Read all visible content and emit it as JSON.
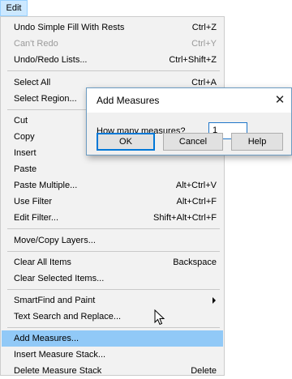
{
  "menubar": {
    "edit_label": "Edit"
  },
  "menu": {
    "items": [
      {
        "label": "Undo Simple Fill With Rests",
        "shortcut": "Ctrl+Z"
      },
      {
        "label": "Can't Redo",
        "shortcut": "Ctrl+Y",
        "disabled": true
      },
      {
        "label": "Undo/Redo Lists...",
        "shortcut": "Ctrl+Shift+Z"
      },
      {
        "label": "Select All",
        "shortcut": "Ctrl+A"
      },
      {
        "label": "Select Region...",
        "shortcut": ""
      },
      {
        "label": "Cut",
        "shortcut": ""
      },
      {
        "label": "Copy",
        "shortcut": ""
      },
      {
        "label": "Insert",
        "shortcut": ""
      },
      {
        "label": "Paste",
        "shortcut": ""
      },
      {
        "label": "Paste Multiple...",
        "shortcut": "Alt+Ctrl+V"
      },
      {
        "label": "Use Filter",
        "shortcut": "Alt+Ctrl+F"
      },
      {
        "label": "Edit Filter...",
        "shortcut": "Shift+Alt+Ctrl+F"
      },
      {
        "label": "Move/Copy Layers...",
        "shortcut": ""
      },
      {
        "label": "Clear All Items",
        "shortcut": "Backspace"
      },
      {
        "label": "Clear Selected Items...",
        "shortcut": ""
      },
      {
        "label": "SmartFind and Paint",
        "shortcut": "",
        "submenu": true
      },
      {
        "label": "Text Search and Replace...",
        "shortcut": ""
      },
      {
        "label": "Add Measures...",
        "shortcut": "",
        "highlighted": true
      },
      {
        "label": "Insert Measure Stack...",
        "shortcut": ""
      },
      {
        "label": "Delete Measure Stack",
        "shortcut": "Delete"
      }
    ]
  },
  "dialog": {
    "title": "Add Measures",
    "close_glyph": "✕",
    "prompt": "How many measures?",
    "value": "1",
    "ok_label": "OK",
    "cancel_label": "Cancel",
    "help_label": "Help"
  },
  "colors": {
    "highlight": "#91c9f7",
    "menu_bg": "#f2f2f2",
    "menubar_active": "#cce8ff",
    "dialog_border": "#6c9cc2"
  },
  "icons": {
    "cursor": "mouse-pointer-icon",
    "submenu": "submenu-arrow-icon",
    "close": "close-icon"
  }
}
